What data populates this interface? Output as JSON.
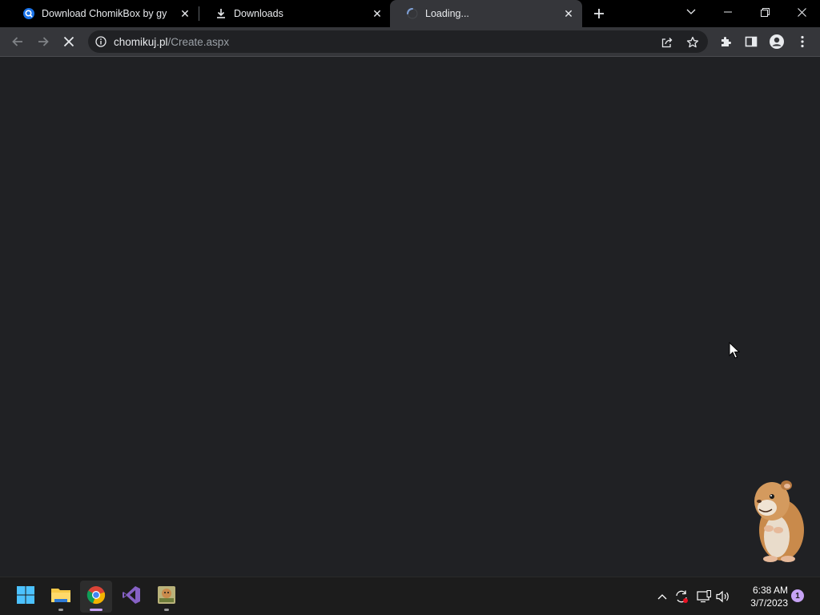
{
  "tabs": [
    {
      "title": "Download ChomikBox by gy",
      "favicon": "search-favicon-icon"
    },
    {
      "title": "Downloads",
      "favicon": "download-icon"
    },
    {
      "title": "Loading...",
      "favicon": "spinner-icon",
      "active": true
    }
  ],
  "omnibox": {
    "host": "chomikuj.pl",
    "path": "/Create.aspx"
  },
  "taskbar": {
    "apps": [
      "windows-start-icon",
      "file-explorer-icon",
      "chrome-icon",
      "visual-studio-icon",
      "chomikbox-icon"
    ],
    "time": "6:38 AM",
    "date": "3/7/2023",
    "notification_count": "1"
  },
  "colors": {
    "tabstrip": "#000000",
    "toolbar": "#35363a",
    "content": "#202124",
    "taskbar": "#1c1c1c",
    "accent": "#c7a3f5"
  }
}
